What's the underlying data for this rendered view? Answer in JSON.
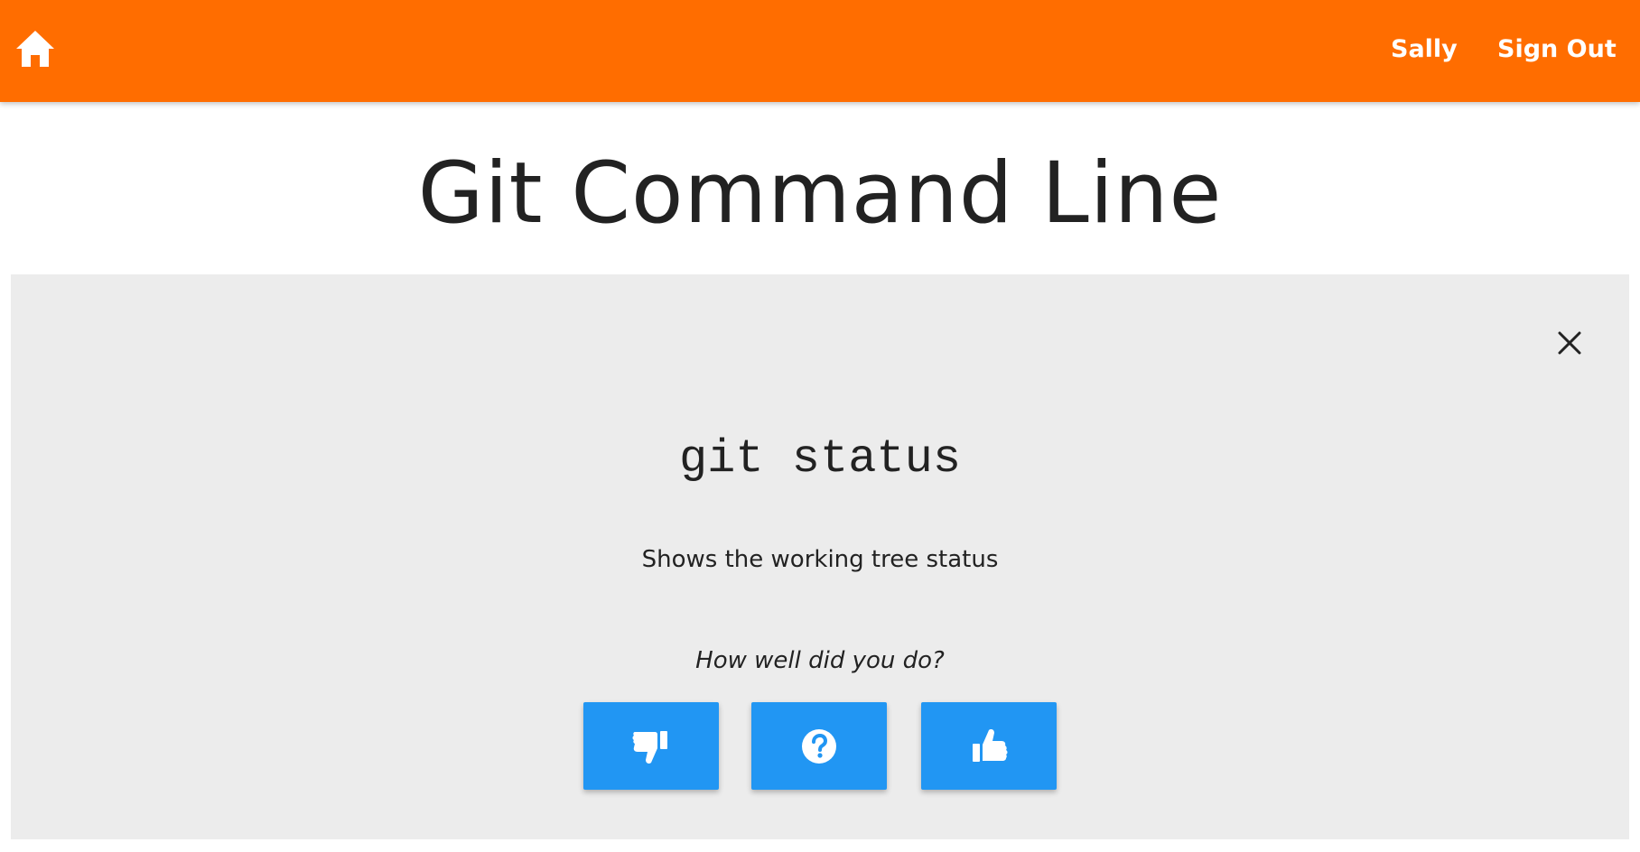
{
  "header": {
    "home_icon": "home-icon",
    "user_name": "Sally",
    "sign_out_label": "Sign Out",
    "brand_color": "#ff6d00"
  },
  "page": {
    "title": "Git Command Line"
  },
  "card": {
    "close_icon": "close-icon",
    "command": "git status",
    "description": "Shows the working tree status",
    "prompt": "How well did you do?",
    "background_color": "#ececec",
    "rating_buttons": [
      {
        "icon": "thumbs-down-icon"
      },
      {
        "icon": "question-circle-icon"
      },
      {
        "icon": "thumbs-up-icon"
      }
    ],
    "button_color": "#2196f3"
  }
}
